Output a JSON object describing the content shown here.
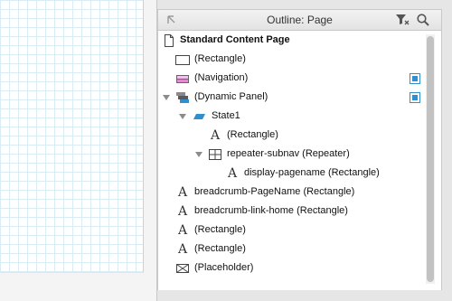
{
  "outline": {
    "title": "Outline: Page",
    "items": [
      {
        "label": "Standard Content Page",
        "icon": "page-icon"
      },
      {
        "label": "(Rectangle)",
        "icon": "rectangle-icon"
      },
      {
        "label": "(Navigation)",
        "icon": "navigation-icon"
      },
      {
        "label": "(Dynamic Panel)",
        "icon": "dynamic-panel-icon"
      },
      {
        "label": "State1",
        "icon": "state-icon"
      },
      {
        "label": "(Rectangle)",
        "icon": "text-icon"
      },
      {
        "label": "repeater-subnav (Repeater)",
        "icon": "repeater-icon"
      },
      {
        "label": "display-pagename (Rectangle)",
        "icon": "text-icon"
      },
      {
        "label": "breadcrumb-PageName (Rectangle)",
        "icon": "text-icon"
      },
      {
        "label": "breadcrumb-link-home (Rectangle)",
        "icon": "text-icon"
      },
      {
        "label": "(Rectangle)",
        "icon": "text-icon"
      },
      {
        "label": "(Rectangle)",
        "icon": "text-icon"
      },
      {
        "label": "(Placeholder)",
        "icon": "placeholder-icon"
      }
    ]
  },
  "colors": {
    "accent": "#2f8fcf",
    "navigation_icon": "#e08ad0",
    "grid": "#d9ecf4"
  }
}
